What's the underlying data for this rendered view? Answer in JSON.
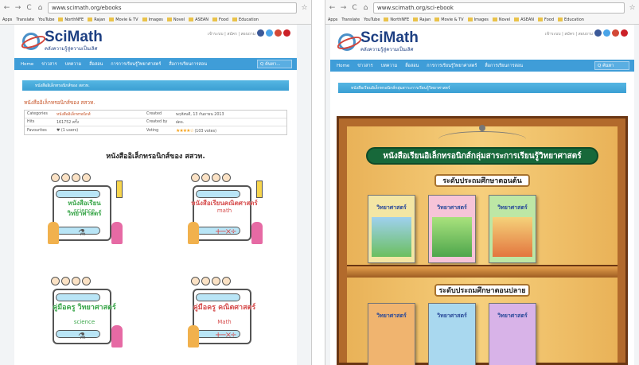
{
  "left": {
    "url": "www.scimath.org/ebooks",
    "bookmarks": [
      "Apps",
      "Translate",
      "YouTube",
      "NorthNFE",
      "Rajan",
      "Movie & TV",
      "Images",
      "Novel",
      "ASEAN",
      "Food",
      "Education"
    ],
    "site": {
      "logo_name": "SciMath",
      "logo_tag": "คลังความรู้สู่ความเป็นเลิศ",
      "top_links": "เข้าระบบ | สมัคร | สอบถาม",
      "menu": [
        "Home",
        "ข่าวสาร",
        "บทความ",
        "สื่อสอน",
        "การการเรียนรู้วิทยาศาสตร์",
        "สื่อการเรียนการสอน"
      ],
      "search_placeholder": "Q ค้นหา...",
      "breadcrumb": "หนังสืออิเล็กทรอนิกส์ของ สสวท.",
      "article_title": "หนังสืออิเล็กทรอนิกส์ของ สสวท.",
      "info": {
        "category_label": "Categories",
        "category_value": "หนังสืออิเล็กทรอนิกส์",
        "created_label": "Created",
        "created_value": "พฤหัสบดี, 13 กันยายน 2013",
        "hits_label": "Hits",
        "hits_value": "161752 ครั้ง",
        "created_by_label": "Created by",
        "created_by_value": "ฝดจ.",
        "favourites_label": "Favourites",
        "favourites_value": "(1 users)",
        "voting_label": "Voting",
        "voting_value": "(103 votes)"
      },
      "heading": "หนังสืออิเล็กทรอนิกส์ของ สสวท.",
      "covers": [
        {
          "title": "หนังสือเรียนวิทยาศาสตร์",
          "sub": "science"
        },
        {
          "title": "หนังสือเรียนคณิตศาสตร์",
          "sub": "math"
        },
        {
          "title": "คู่มือครู วิทยาศาสตร์",
          "sub": "science"
        },
        {
          "title": "คู่มือครู คณิตศาสตร์",
          "sub": "Math"
        }
      ]
    }
  },
  "right": {
    "url": "www.scimath.org/sci-ebook",
    "bookmarks": [
      "Apps",
      "Translate",
      "YouTube",
      "NorthNFE",
      "Rajan",
      "Movie & TV",
      "Images",
      "Novel",
      "ASEAN",
      "Food",
      "Education"
    ],
    "site": {
      "logo_name": "SciMath",
      "logo_tag": "คลังความรู้สู่ความเป็นเลิศ",
      "top_links": "เข้าระบบ | สมัคร | สอบถาม",
      "menu": [
        "Home",
        "ข่าวสาร",
        "บทความ",
        "สื่อสอน",
        "การการเรียนรู้วิทยาศาสตร์",
        "สื่อการเรียนการสอน"
      ],
      "search_placeholder": "Q ค้นหา",
      "breadcrumb": "หนังสือเรียนอิเล็กทรอนิกส์กลุ่มสาระการเรียนรู้วิทยาศาสตร์",
      "banner": "หนังสือเรียนอิเล็กทรอนิกส์กลุ่มสาระการเรียนรู้วิทยาศาสตร์",
      "level1": "ระดับประถมศึกษาตอนต้น",
      "level2": "ระดับประถมศึกษาตอนปลาย",
      "book_label": "วิทยาศาสตร์"
    }
  },
  "colors": {
    "menu_blue": "#3f9dd8",
    "brand": "#1d3f82",
    "green_banner": "#17683a"
  }
}
